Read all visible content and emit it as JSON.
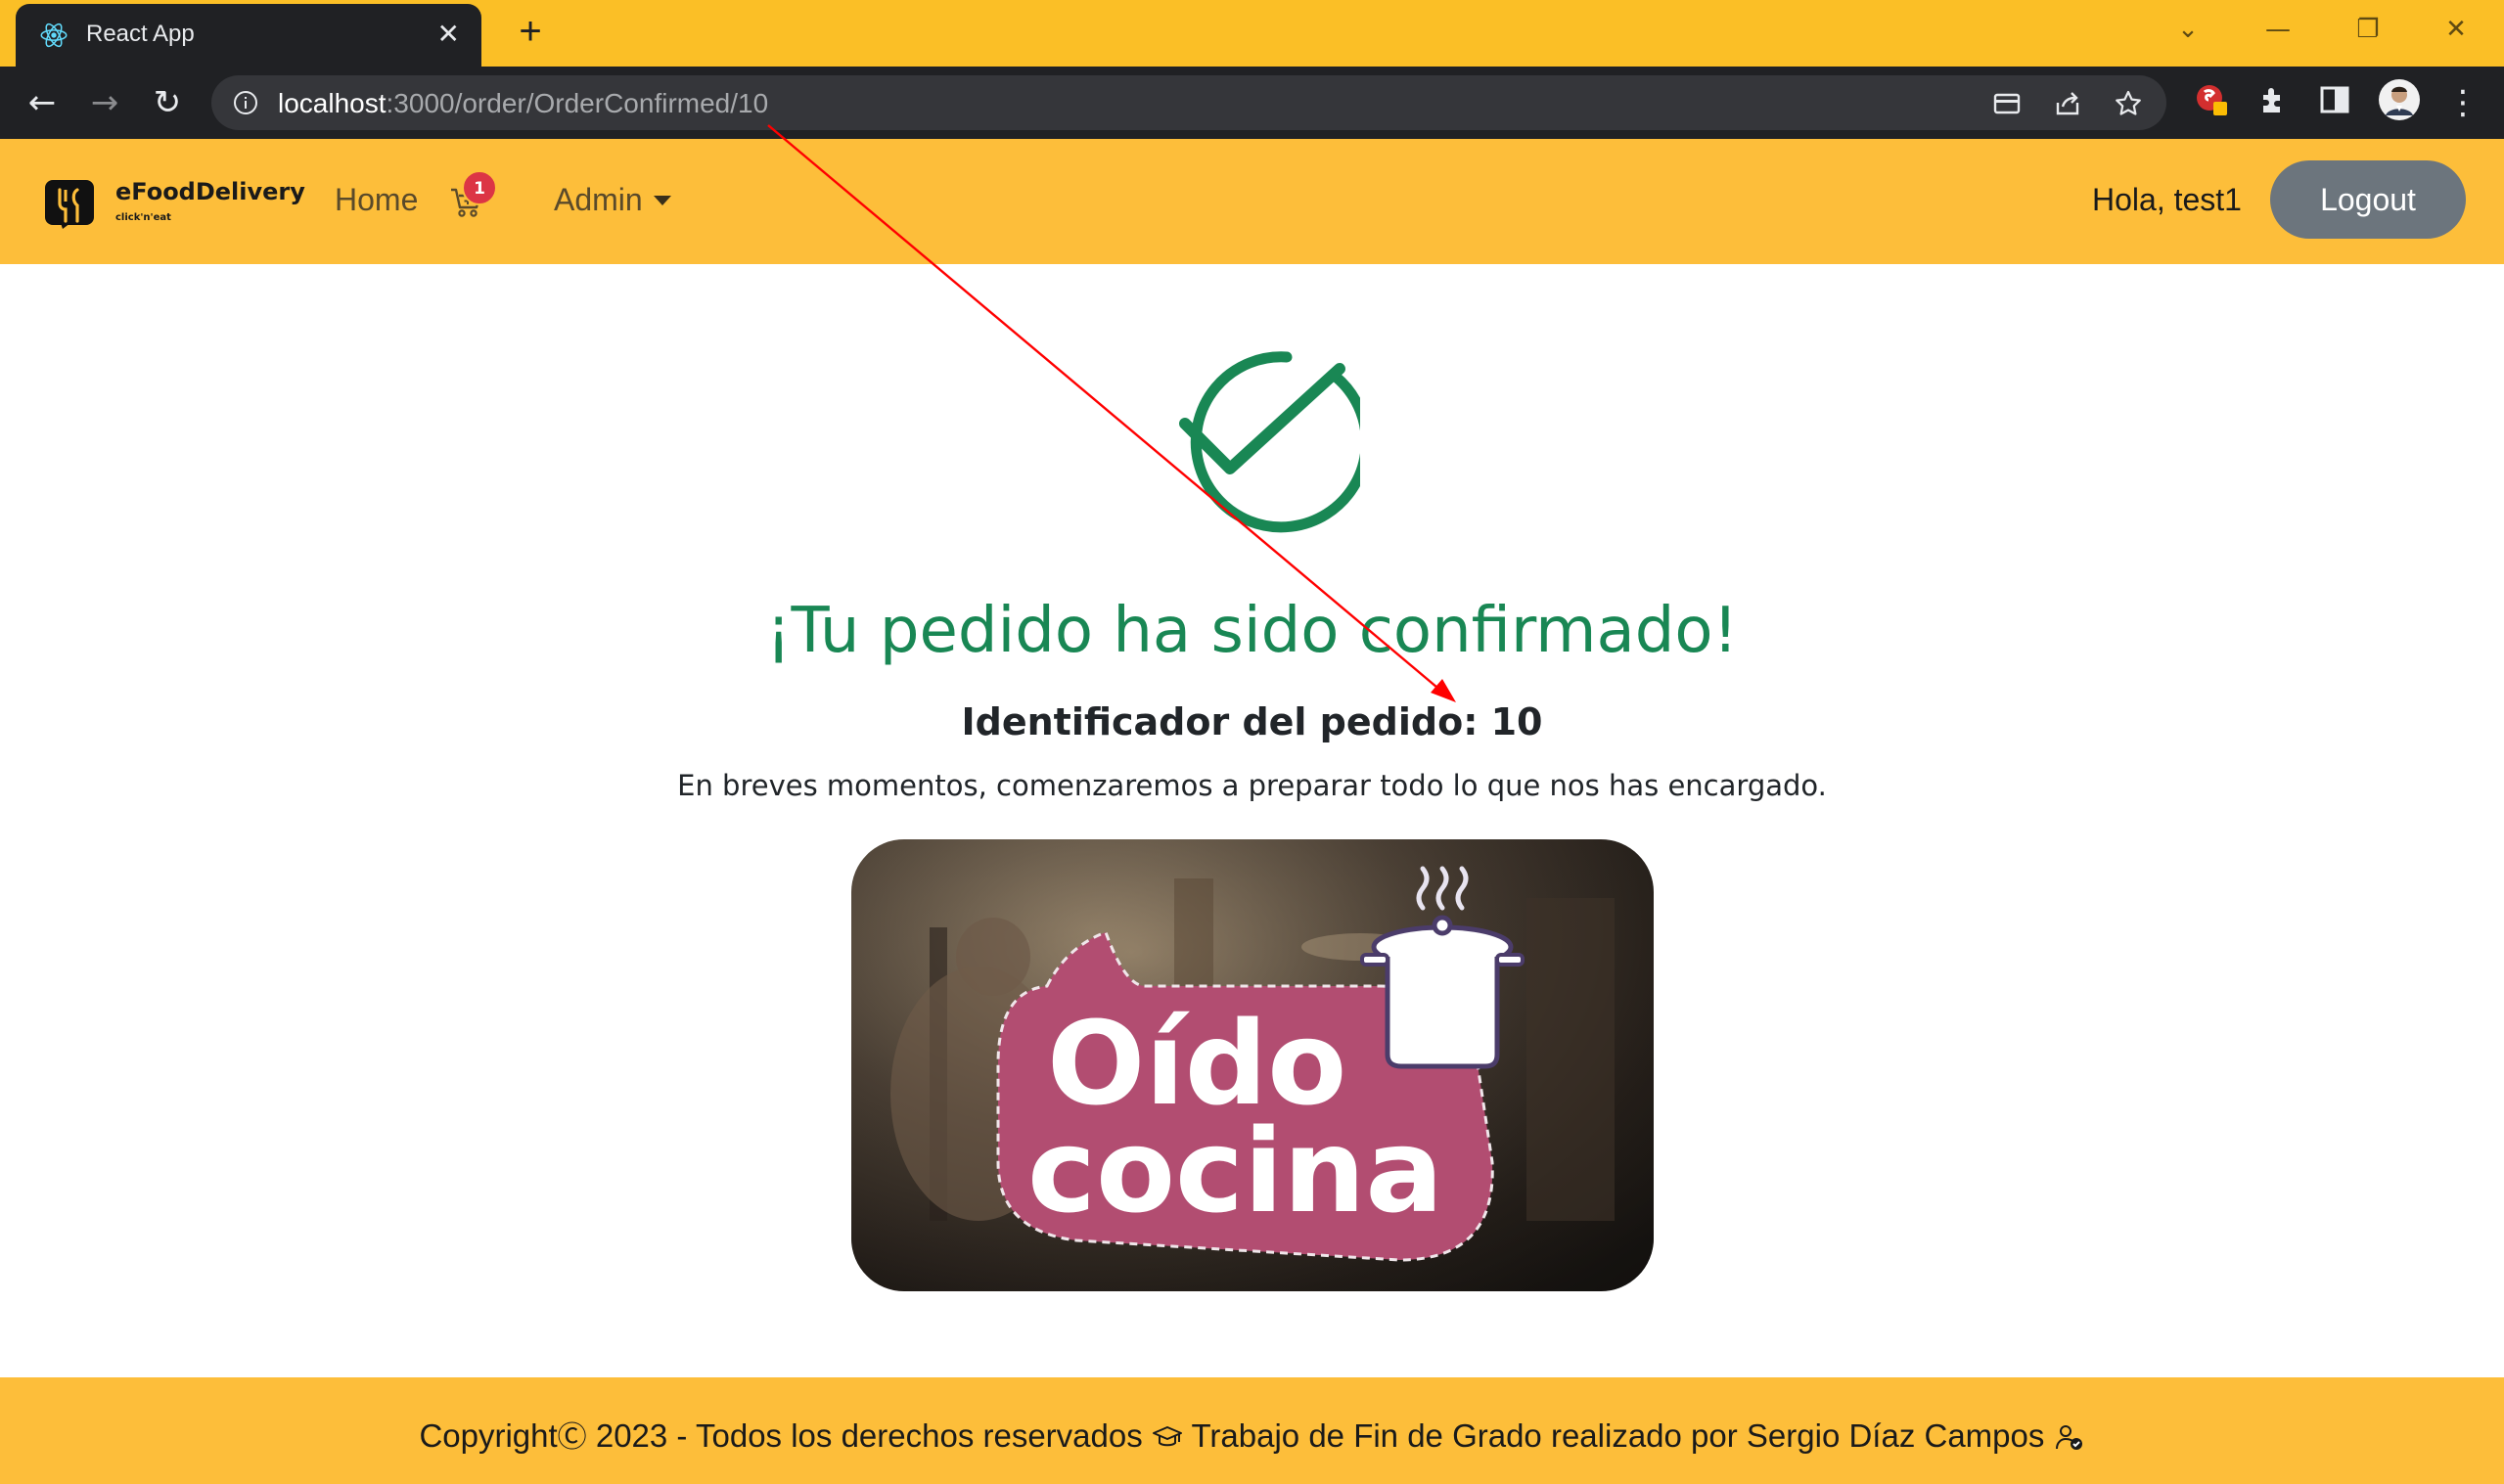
{
  "browser": {
    "tab_title": "React App",
    "url_host": "localhost",
    "url_path": ":3000/order/OrderConfirmed/10",
    "minimize": "—",
    "restore": "❐",
    "close": "✕"
  },
  "navbar": {
    "brand_name": "eFoodDelivery",
    "brand_tagline": "click'n'eat",
    "home": "Home",
    "cart_count": "1",
    "admin": "Admin",
    "greeting": "Hola, test1",
    "logout": "Logout"
  },
  "main": {
    "title": "¡Tu pedido ha sido confirmado!",
    "order_id": "Identificador del pedido: 10",
    "message": "En breves momentos, comenzaremos a preparar todo lo que nos has encargado.",
    "image_text_line1": "Oído",
    "image_text_line2": "cocina"
  },
  "footer": {
    "text_part1": "Copyright",
    "text_part2": " 2023 - Todos los derechos reservados ",
    "text_part3": " Trabajo de Fin de Grado realizado por Sergio Díaz Campos ",
    "copyright_symbol": "Ⓒ"
  },
  "colors": {
    "accent": "#fdbe3a",
    "success": "#198754",
    "logout_bg": "#6c757d",
    "badge": "#dc3545"
  },
  "icons": [
    "react-icon",
    "back-icon",
    "forward-icon",
    "reload-icon",
    "info-icon",
    "card-icon",
    "share-icon",
    "star-icon",
    "extensions-icon",
    "sidepanel-icon",
    "menu-icon",
    "cart-icon",
    "check-icon",
    "cap-icon",
    "user-check-icon"
  ]
}
